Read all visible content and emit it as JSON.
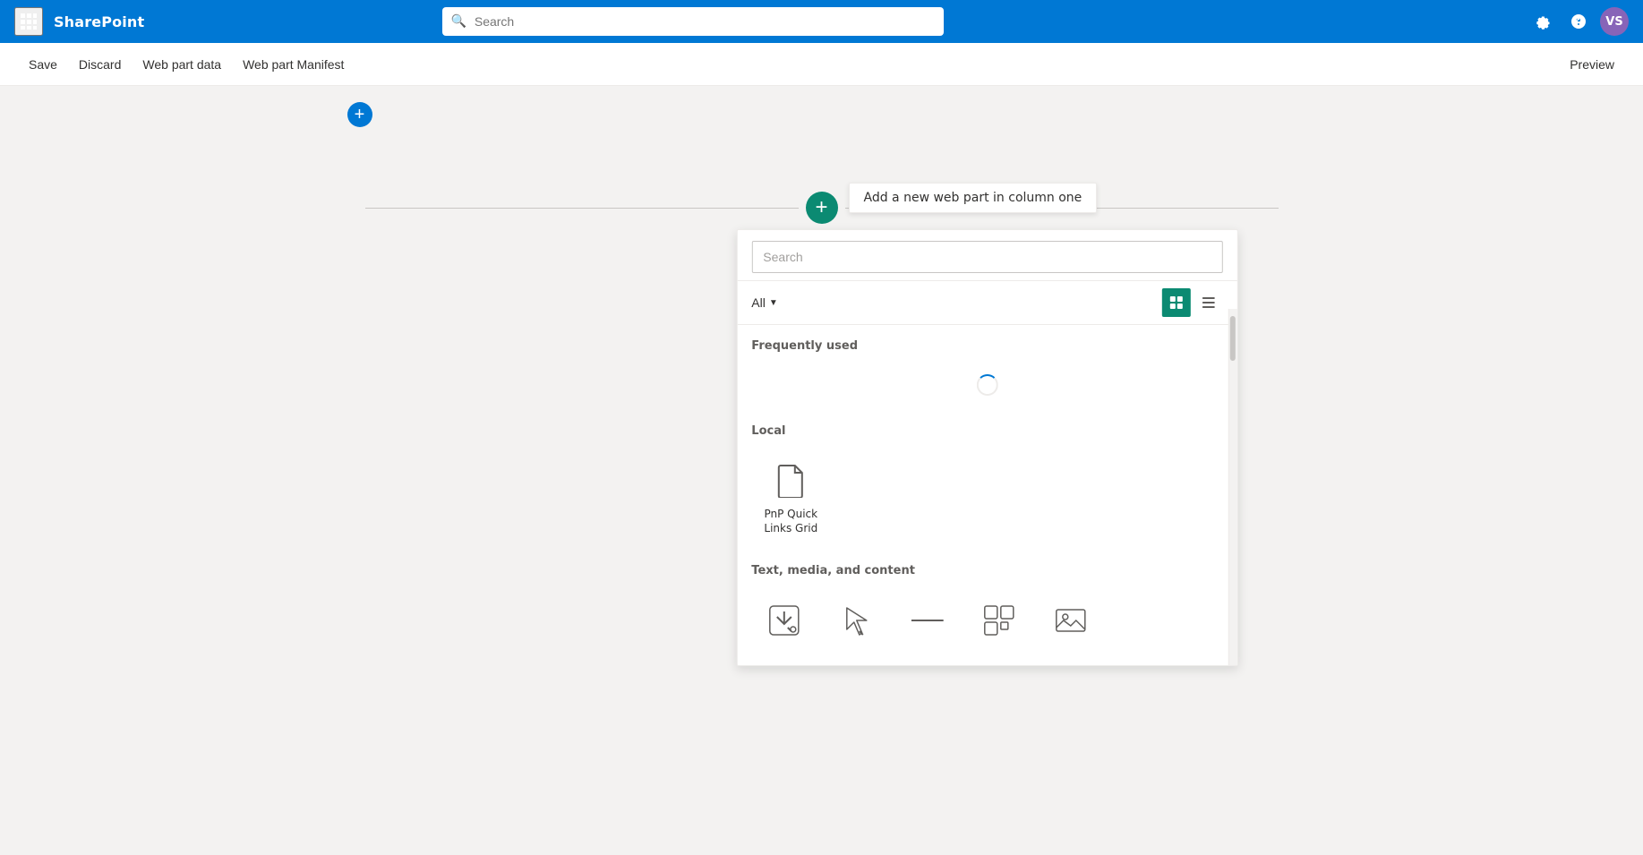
{
  "app": {
    "name": "SharePoint"
  },
  "nav": {
    "search_placeholder": "Search",
    "avatar_initials": "VS",
    "avatar_bg": "#8764b8"
  },
  "toolbar": {
    "save_label": "Save",
    "discard_label": "Discard",
    "web_part_data_label": "Web part data",
    "web_part_manifest_label": "Web part Manifest",
    "preview_label": "Preview"
  },
  "page": {
    "add_row_tooltip": "Add a new web part in column one"
  },
  "picker": {
    "search_placeholder": "Search",
    "filter_label": "All",
    "frequently_used_title": "Frequently used",
    "local_title": "Local",
    "text_media_title": "Text, media, and content",
    "local_items": [
      {
        "id": "pnp-quick",
        "label": "PnP Quick Links Grid",
        "icon_type": "doc"
      }
    ]
  }
}
